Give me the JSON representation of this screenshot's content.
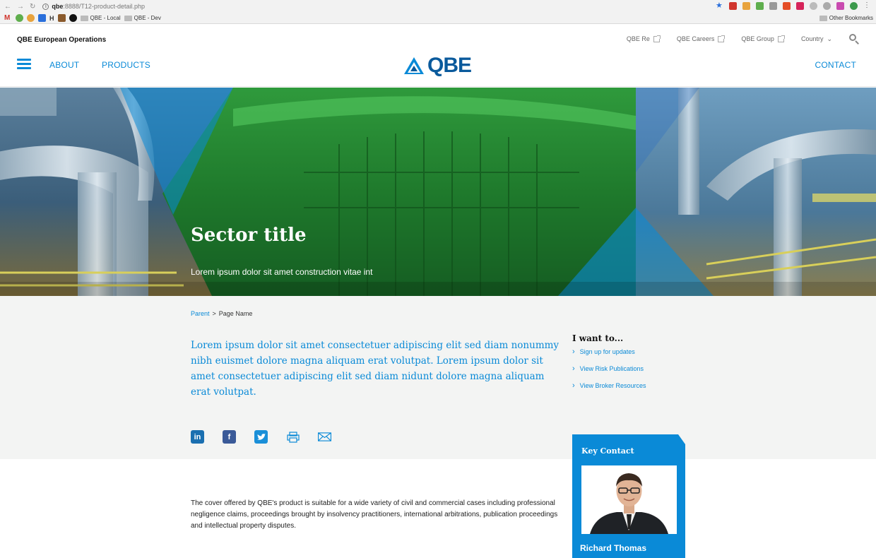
{
  "browser": {
    "url_host": "qbe",
    "url_rest": ":8888/T12-product-detail.php",
    "bookmarks": [
      "QBE - Local",
      "QBE - Dev"
    ],
    "bookmark_letter": "H",
    "other_bookmarks": "Other Bookmarks"
  },
  "header": {
    "site_name": "QBE European Operations",
    "util_links": [
      "QBE Re",
      "QBE Careers",
      "QBE Group"
    ],
    "country": "Country",
    "nav": [
      "ABOUT",
      "PRODUCTS"
    ],
    "contact": "CONTACT",
    "logo_text": "QBE"
  },
  "hero": {
    "title": "Sector title",
    "subtitle": "Lorem ipsum dolor sit amet construction vitae int"
  },
  "breadcrumb": {
    "parent": "Parent",
    "separator": ">",
    "current": "Page Name"
  },
  "lead": "Lorem ipsum dolor sit amet consectetuer adipiscing elit sed diam nonummy nibh euismet dolore magna aliquam erat volutpat. Lorem ipsum dolor sit amet consectetuer adipiscing elit sed diam nidunt dolore magna aliquam erat volutpat.",
  "sidebar": {
    "heading": "I want to...",
    "links": [
      "Sign up for updates",
      "View Risk Publications",
      "View Broker Resources"
    ]
  },
  "social": {
    "linkedin": "in",
    "facebook": "f"
  },
  "body_text": "The cover offered by QBE's product is suitable for a wide variety of civil and commercial cases including professional negligence claims, proceedings brought by insolvency practitioners, international arbitrations, publication proceedings and intellectual property disputes.",
  "key_contact": {
    "heading": "Key Contact",
    "name": "Richard Thomas"
  },
  "colors": {
    "brand_blue": "#0a8ad7",
    "logo_navy": "#0a5a9c",
    "band_grey": "#f3f4f3"
  }
}
